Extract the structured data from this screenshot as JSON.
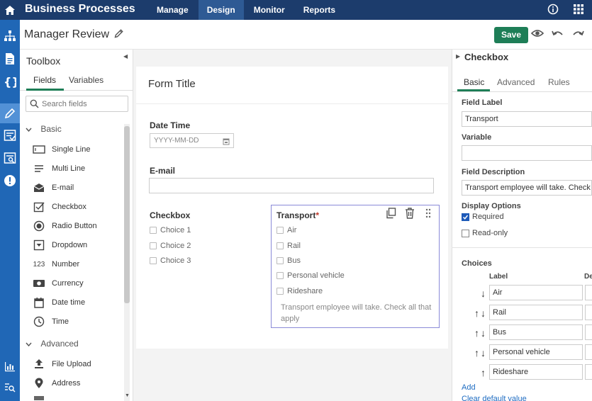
{
  "app": {
    "title": "Business Processes"
  },
  "topnav": [
    {
      "label": "Manage",
      "active": false
    },
    {
      "label": "Design",
      "active": true
    },
    {
      "label": "Monitor",
      "active": false
    },
    {
      "label": "Reports",
      "active": false
    }
  ],
  "header": {
    "form_name": "Manager Review",
    "save_label": "Save"
  },
  "toolbox": {
    "title": "Toolbox",
    "tabs": [
      "Fields",
      "Variables"
    ],
    "search_placeholder": "Search fields",
    "group_basic": "Basic",
    "group_advanced": "Advanced",
    "basic_items": [
      "Single Line",
      "Multi Line",
      "E-mail",
      "Checkbox",
      "Radio Button",
      "Dropdown",
      "Number",
      "Currency",
      "Date time",
      "Time"
    ],
    "advanced_items": [
      "File Upload",
      "Address"
    ],
    "number_icon_text": "123"
  },
  "form": {
    "title": "Form Title",
    "date_label": "Date Time",
    "date_placeholder": "YYYY-MM-DD",
    "email_label": "E-mail",
    "checkbox_label": "Checkbox",
    "checkbox_choices": [
      "Choice 1",
      "Choice 2",
      "Choice 3"
    ],
    "transport_label": "Transport",
    "required_mark": "*",
    "transport_choices": [
      "Air",
      "Rail",
      "Bus",
      "Personal vehicle",
      "Rideshare"
    ],
    "transport_help": "Transport employee will take. Check all that apply"
  },
  "panel": {
    "title": "Checkbox",
    "tabs": [
      "Basic",
      "Advanced",
      "Rules"
    ],
    "field_label_title": "Field Label",
    "field_label_value": "Transport",
    "variable_title": "Variable",
    "variable_value": "",
    "description_title": "Field Description",
    "description_value": "Transport employee will take. Check a",
    "display_options_title": "Display Options",
    "required_label": "Required",
    "required_checked": true,
    "readonly_label": "Read-only",
    "readonly_checked": false,
    "choices_title": "Choices",
    "choices_col_label": "Label",
    "choices_col_default": "De",
    "choices": [
      {
        "arrows": "↓",
        "label": "Air"
      },
      {
        "arrows": "↑↓",
        "label": "Rail"
      },
      {
        "arrows": "↑↓",
        "label": "Bus"
      },
      {
        "arrows": "↑↓",
        "label": "Personal vehicle"
      },
      {
        "arrows": "↑",
        "label": "Rideshare"
      }
    ],
    "add_label": "Add",
    "clear_label": "Clear default value"
  },
  "colors": {
    "topbar": "#1c3c6c",
    "rail": "#2067b6",
    "save": "#1e7e57",
    "accent": "#1e7e57",
    "selected_border": "#8a8ad8"
  }
}
